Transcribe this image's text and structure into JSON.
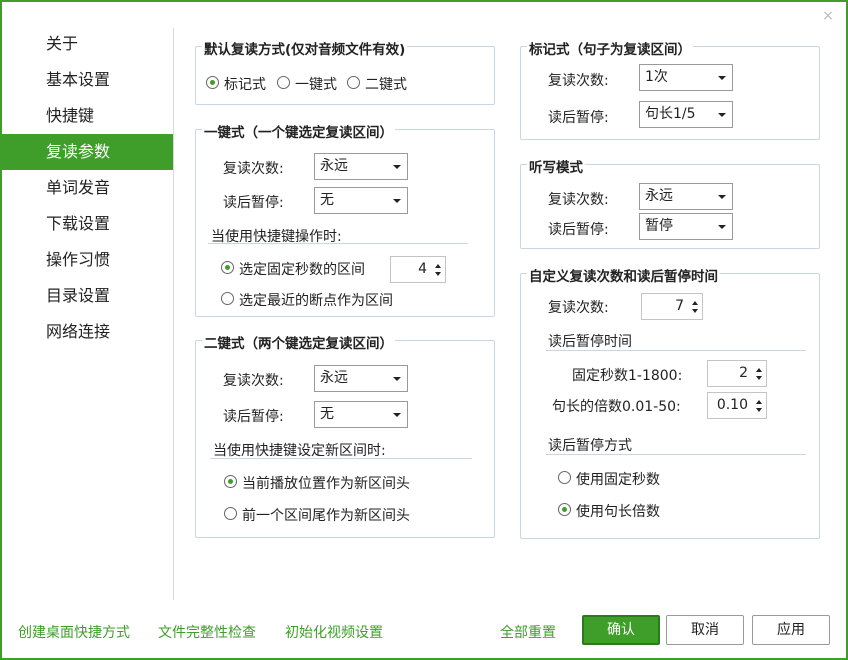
{
  "window": {
    "close_glyph": "×"
  },
  "sidebar": {
    "items": [
      {
        "label": "关于"
      },
      {
        "label": "基本设置"
      },
      {
        "label": "快捷键"
      },
      {
        "label": "复读参数"
      },
      {
        "label": "单词发音"
      },
      {
        "label": "下载设置"
      },
      {
        "label": "操作习惯"
      },
      {
        "label": "目录设置"
      },
      {
        "label": "网络连接"
      }
    ],
    "active_index": 3
  },
  "default_mode": {
    "title": "默认复读方式(仅对音频文件有效)",
    "options": [
      "标记式",
      "一键式",
      "二键式"
    ],
    "selected": "标记式"
  },
  "one_key": {
    "title": "一键式（一个键选定复读区间）",
    "repeat_label": "复读次数:",
    "repeat_value": "永远",
    "pause_label": "读后暂停:",
    "pause_value": "无",
    "shortcut_header": "当使用快捷键操作时:",
    "option_fixed": "选定固定秒数的区间",
    "fixed_seconds": "4",
    "option_recent": "选定最近的断点作为区间"
  },
  "two_key": {
    "title": "二键式（两个键选定复读区间）",
    "repeat_label": "复读次数:",
    "repeat_value": "永远",
    "pause_label": "读后暂停:",
    "pause_value": "无",
    "shortcut_header": "当使用快捷键设定新区间时:",
    "option_current": "当前播放位置作为新区间头",
    "option_prev": "前一个区间尾作为新区间头"
  },
  "mark_mode": {
    "title": "标记式（句子为复读区间）",
    "repeat_label": "复读次数:",
    "repeat_value": "1次",
    "pause_label": "读后暂停:",
    "pause_value": "句长1/5"
  },
  "dictation": {
    "title": "听写模式",
    "repeat_label": "复读次数:",
    "repeat_value": "永远",
    "pause_label": "读后暂停:",
    "pause_value": "暂停"
  },
  "custom": {
    "title": "自定义复读次数和读后暂停时间",
    "repeat_label": "复读次数:",
    "repeat_value": "7",
    "pause_time_header": "读后暂停时间",
    "fixed_label": "固定秒数1-1800:",
    "fixed_value": "2",
    "multiple_label": "句长的倍数0.01-50:",
    "multiple_value": "0.10",
    "pause_mode_header": "读后暂停方式",
    "option_fixed": "使用固定秒数",
    "option_multiple": "使用句长倍数"
  },
  "footer": {
    "link_shortcut": "创建桌面快捷方式",
    "link_integrity": "文件完整性检查",
    "link_video": "初始化视频设置",
    "link_reset": "全部重置",
    "btn_ok": "确认",
    "btn_cancel": "取消",
    "btn_apply": "应用"
  },
  "colors": {
    "accent": "#3f9e2a",
    "group_border": "#c8d6e5"
  }
}
